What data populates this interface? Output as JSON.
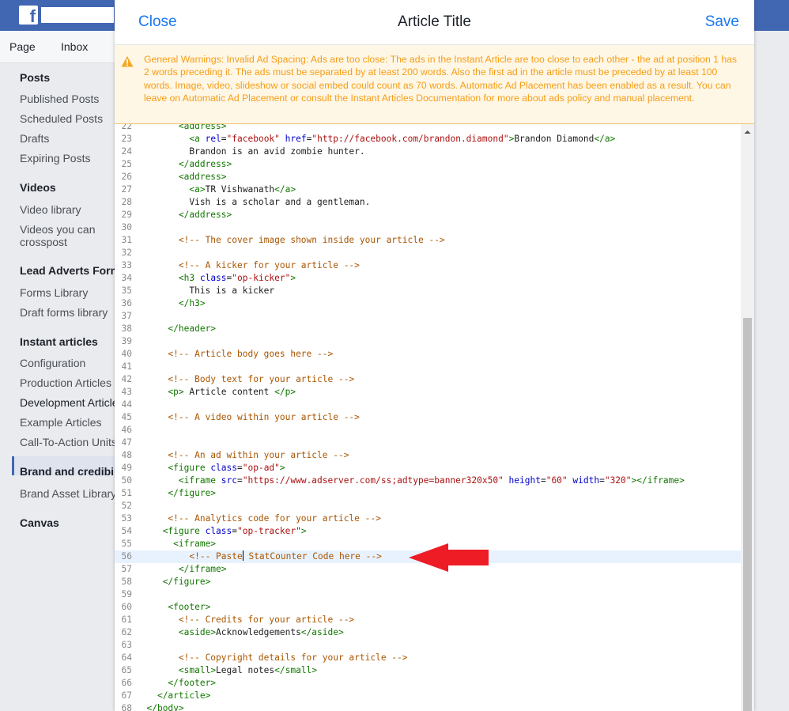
{
  "pagetabs": [
    "Page",
    "Inbox"
  ],
  "leftnav": [
    {
      "type": "h",
      "label": "Posts"
    },
    {
      "type": "i",
      "label": "Published Posts"
    },
    {
      "type": "i",
      "label": "Scheduled Posts"
    },
    {
      "type": "i",
      "label": "Drafts"
    },
    {
      "type": "i",
      "label": "Expiring Posts"
    },
    {
      "type": "h",
      "label": "Videos"
    },
    {
      "type": "i",
      "label": "Video library"
    },
    {
      "type": "i",
      "label": "Videos you can crosspost"
    },
    {
      "type": "h",
      "label": "Lead Adverts Forms"
    },
    {
      "type": "i",
      "label": "Forms Library"
    },
    {
      "type": "i",
      "label": "Draft forms library"
    },
    {
      "type": "h",
      "label": "Instant articles"
    },
    {
      "type": "i",
      "label": "Configuration"
    },
    {
      "type": "i",
      "label": "Production Articles"
    },
    {
      "type": "i",
      "label": "Development Articles",
      "active": true
    },
    {
      "type": "i",
      "label": "Example Articles"
    },
    {
      "type": "i",
      "label": "Call-To-Action Units"
    },
    {
      "type": "h",
      "label": "Brand and credibility"
    },
    {
      "type": "i",
      "label": "Brand Asset Library"
    },
    {
      "type": "h",
      "label": "Canvas"
    }
  ],
  "modal": {
    "close_label": "Close",
    "title": "Article Title",
    "save_label": "Save",
    "warning": "General Warnings: Invalid Ad Spacing: Ads are too close: The ads in the Instant Article are too close to each other - the ad at position 1 has 2 words preceding it. The ads must be separated by at least 200 words. Also the first ad in the article must be preceded by at least 100 words. Image, video, slideshow or social embed could count as 70 words. Automatic Ad Placement has been enabled as a result. You can leave on Automatic Ad Placement or consult the Instant Articles Documentation for more about ads policy and manual placement."
  },
  "editor": {
    "active_line": 56,
    "lines": [
      {
        "n": 22,
        "tokens": [
          [
            "",
            "        "
          ],
          [
            "t",
            "<address>"
          ]
        ]
      },
      {
        "n": 23,
        "tokens": [
          [
            "",
            "          "
          ],
          [
            "t",
            "<a "
          ],
          [
            "a",
            "rel"
          ],
          [
            "",
            "="
          ],
          [
            "s",
            "\"facebook\""
          ],
          [
            "a",
            " href"
          ],
          [
            "",
            "="
          ],
          [
            "s",
            "\"http://facebook.com/brandon.diamond\""
          ],
          [
            "t",
            ">"
          ],
          [
            "",
            "Brandon Diamond"
          ],
          [
            "t",
            "</a>"
          ]
        ]
      },
      {
        "n": 24,
        "tokens": [
          [
            "",
            "          Brandon is an avid zombie hunter."
          ]
        ]
      },
      {
        "n": 25,
        "tokens": [
          [
            "",
            "        "
          ],
          [
            "t",
            "</address>"
          ]
        ]
      },
      {
        "n": 26,
        "tokens": [
          [
            "",
            "        "
          ],
          [
            "t",
            "<address>"
          ]
        ]
      },
      {
        "n": 27,
        "tokens": [
          [
            "",
            "          "
          ],
          [
            "t",
            "<a>"
          ],
          [
            "",
            "TR Vishwanath"
          ],
          [
            "t",
            "</a>"
          ]
        ]
      },
      {
        "n": 28,
        "tokens": [
          [
            "",
            "          Vish is a scholar and a gentleman."
          ]
        ]
      },
      {
        "n": 29,
        "tokens": [
          [
            "",
            "        "
          ],
          [
            "t",
            "</address>"
          ]
        ]
      },
      {
        "n": 30,
        "tokens": []
      },
      {
        "n": 31,
        "tokens": [
          [
            "",
            "        "
          ],
          [
            "c",
            "<!-- The cover image shown inside your article -->"
          ]
        ]
      },
      {
        "n": 32,
        "tokens": []
      },
      {
        "n": 33,
        "tokens": [
          [
            "",
            "        "
          ],
          [
            "c",
            "<!-- A kicker for your article -->"
          ]
        ]
      },
      {
        "n": 34,
        "tokens": [
          [
            "",
            "        "
          ],
          [
            "t",
            "<h3 "
          ],
          [
            "a",
            "class"
          ],
          [
            "",
            "="
          ],
          [
            "s",
            "\"op-kicker\""
          ],
          [
            "t",
            ">"
          ]
        ]
      },
      {
        "n": 35,
        "tokens": [
          [
            "",
            "          This is a kicker"
          ]
        ]
      },
      {
        "n": 36,
        "tokens": [
          [
            "",
            "        "
          ],
          [
            "t",
            "</h3>"
          ]
        ]
      },
      {
        "n": 37,
        "tokens": []
      },
      {
        "n": 38,
        "tokens": [
          [
            "",
            "      "
          ],
          [
            "t",
            "</header>"
          ]
        ]
      },
      {
        "n": 39,
        "tokens": []
      },
      {
        "n": 40,
        "tokens": [
          [
            "",
            "      "
          ],
          [
            "c",
            "<!-- Article body goes here -->"
          ]
        ]
      },
      {
        "n": 41,
        "tokens": []
      },
      {
        "n": 42,
        "tokens": [
          [
            "",
            "      "
          ],
          [
            "c",
            "<!-- Body text for your article -->"
          ]
        ]
      },
      {
        "n": 43,
        "tokens": [
          [
            "",
            "      "
          ],
          [
            "t",
            "<p>"
          ],
          [
            "",
            " Article content "
          ],
          [
            "t",
            "</p>"
          ]
        ]
      },
      {
        "n": 44,
        "tokens": []
      },
      {
        "n": 45,
        "tokens": [
          [
            "",
            "      "
          ],
          [
            "c",
            "<!-- A video within your article -->"
          ]
        ]
      },
      {
        "n": 46,
        "tokens": []
      },
      {
        "n": 47,
        "tokens": []
      },
      {
        "n": 48,
        "tokens": [
          [
            "",
            "      "
          ],
          [
            "c",
            "<!-- An ad within your article -->"
          ]
        ]
      },
      {
        "n": 49,
        "tokens": [
          [
            "",
            "      "
          ],
          [
            "t",
            "<figure "
          ],
          [
            "a",
            "class"
          ],
          [
            "",
            "="
          ],
          [
            "s",
            "\"op-ad\""
          ],
          [
            "t",
            ">"
          ]
        ]
      },
      {
        "n": 50,
        "tokens": [
          [
            "",
            "        "
          ],
          [
            "t",
            "<iframe "
          ],
          [
            "a",
            "src"
          ],
          [
            "",
            "="
          ],
          [
            "s",
            "\"https://www.adserver.com/ss;adtype=banner320x50\""
          ],
          [
            "a",
            " height"
          ],
          [
            "",
            "="
          ],
          [
            "s",
            "\"60\""
          ],
          [
            "a",
            " width"
          ],
          [
            "",
            "="
          ],
          [
            "s",
            "\"320\""
          ],
          [
            "t",
            "></iframe>"
          ]
        ]
      },
      {
        "n": 51,
        "tokens": [
          [
            "",
            "      "
          ],
          [
            "t",
            "</figure>"
          ]
        ]
      },
      {
        "n": 52,
        "tokens": []
      },
      {
        "n": 53,
        "tokens": [
          [
            "",
            "      "
          ],
          [
            "c",
            "<!-- Analytics code for your article -->"
          ]
        ]
      },
      {
        "n": 54,
        "tokens": [
          [
            "",
            "     "
          ],
          [
            "t",
            "<figure "
          ],
          [
            "a",
            "class"
          ],
          [
            "",
            "="
          ],
          [
            "s",
            "\"op-tracker\""
          ],
          [
            "t",
            ">"
          ]
        ]
      },
      {
        "n": 55,
        "tokens": [
          [
            "",
            "       "
          ],
          [
            "t",
            "<iframe>"
          ]
        ]
      },
      {
        "n": 56,
        "tokens": [
          [
            "",
            "          "
          ],
          [
            "c",
            "<!-- Paste"
          ],
          [
            "cursor",
            ""
          ],
          [
            "c",
            " StatCounter Code here -->"
          ]
        ]
      },
      {
        "n": 57,
        "tokens": [
          [
            "",
            "        "
          ],
          [
            "t",
            "</iframe>"
          ]
        ]
      },
      {
        "n": 58,
        "tokens": [
          [
            "",
            "     "
          ],
          [
            "t",
            "</figure>"
          ]
        ]
      },
      {
        "n": 59,
        "tokens": []
      },
      {
        "n": 60,
        "tokens": [
          [
            "",
            "      "
          ],
          [
            "t",
            "<footer>"
          ]
        ]
      },
      {
        "n": 61,
        "tokens": [
          [
            "",
            "        "
          ],
          [
            "c",
            "<!-- Credits for your article -->"
          ]
        ]
      },
      {
        "n": 62,
        "tokens": [
          [
            "",
            "        "
          ],
          [
            "t",
            "<aside>"
          ],
          [
            "",
            "Acknowledgements"
          ],
          [
            "t",
            "</aside>"
          ]
        ]
      },
      {
        "n": 63,
        "tokens": []
      },
      {
        "n": 64,
        "tokens": [
          [
            "",
            "        "
          ],
          [
            "c",
            "<!-- Copyright details for your article -->"
          ]
        ]
      },
      {
        "n": 65,
        "tokens": [
          [
            "",
            "        "
          ],
          [
            "t",
            "<small>"
          ],
          [
            "",
            "Legal notes"
          ],
          [
            "t",
            "</small>"
          ]
        ]
      },
      {
        "n": 66,
        "tokens": [
          [
            "",
            "      "
          ],
          [
            "t",
            "</footer>"
          ]
        ]
      },
      {
        "n": 67,
        "tokens": [
          [
            "",
            "    "
          ],
          [
            "t",
            "</article>"
          ]
        ]
      },
      {
        "n": 68,
        "tokens": [
          [
            "",
            "  "
          ],
          [
            "t",
            "</body>"
          ]
        ]
      }
    ]
  },
  "colors": {
    "fb_blue": "#4267b2",
    "link_blue": "#1877f2",
    "warning_text": "#f59d16",
    "warning_bg": "#fff7e6",
    "arrow_red": "#ee1c25"
  },
  "icons": {
    "warning": "warning-triangle-icon",
    "arrow": "red-arrow-pointer"
  }
}
